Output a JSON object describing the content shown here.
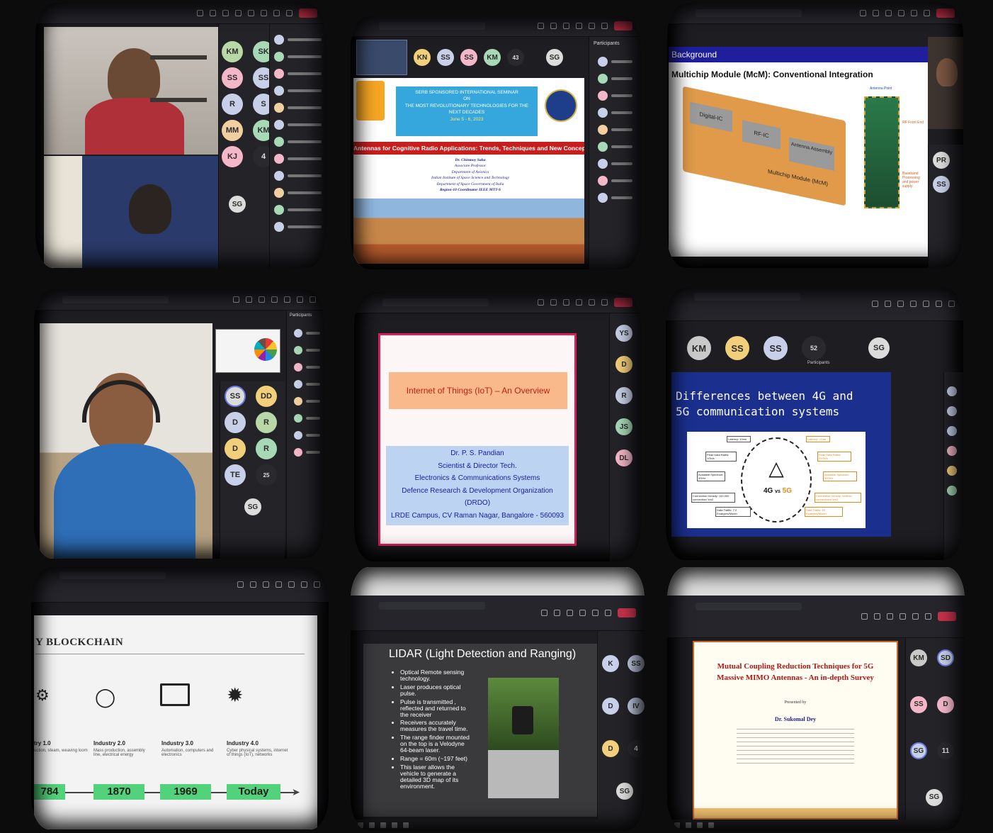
{
  "c1": {
    "participants": [
      "KM",
      "SK",
      "SS",
      "SS",
      "R",
      "S",
      "MM",
      "KM",
      "KJ",
      "4"
    ],
    "self_avatar": "SG"
  },
  "c2": {
    "top_avatars": [
      "KN",
      "SS",
      "SS",
      "KM",
      "43"
    ],
    "self_avatar": "SG",
    "participants_title": "Participants",
    "seminar_line1": "SERB SPONSORED INTERNATIONAL SEMINAR",
    "seminar_line2": "ON",
    "seminar_line3": "THE MOST REVOLUTIONARY TECHNOLOGIES FOR THE",
    "seminar_line4": "NEXT DECADES",
    "seminar_dates": "June 5 - 6, 2023",
    "talk_title": "Antennas for Cognitive Radio Applications: Trends, Techniques and New Concepts",
    "speaker": "Dr. Chinmoy Saha",
    "speaker_role": "Associate Professor",
    "speaker_dept": "Department of Avionics",
    "speaker_inst": "Indian Institute of Space Science and Technology",
    "speaker_inst2": "Department of Space Government of India",
    "speaker_region": "Region-10 Coordinator IEEE MTT-S"
  },
  "c3": {
    "section": "Background",
    "title": "Multichip Module (McM): Conventional Integration",
    "block1": "Digital-IC",
    "block2": "RF-IC",
    "block3": "Antenna Assembly",
    "module_label": "Multichip Module (McM)",
    "antenna_point": "Antenna Point",
    "rf_front_end": "RF Front End",
    "baseband": "Baseband Processing and power supply",
    "side_avatars": [
      "PR",
      "SS"
    ]
  },
  "c4": {
    "participants_title": "Participants",
    "grid": [
      "SS",
      "DD",
      "D",
      "R",
      "D",
      "R",
      "TE",
      "25"
    ],
    "self_avatar": "SG"
  },
  "c5": {
    "title": "Internet of Things (IoT) – An Overview",
    "speaker": "Dr. P. S. Pandian",
    "role": "Scientist & Director Tech.",
    "division": "Electronics & Communications Systems",
    "org": "Defence Research & Development Organization",
    "org_short": "(DRDO)",
    "address": "LRDE Campus, CV Raman Nagar, Bangalore - 560093",
    "side_avatars": [
      "YS",
      "D",
      "R",
      "JS",
      "DL"
    ]
  },
  "c6": {
    "top_avatars": [
      "KM",
      "SS",
      "SS",
      "52"
    ],
    "self_avatar": "SG",
    "participants_label": "Participants",
    "title_line1": "Differences between 4G and",
    "title_line2": "5G communication systems",
    "tower_label_4g": "4G",
    "tower_label_vs": "vs",
    "tower_label_5g": "5G",
    "left_labels": [
      "Latency: 10ms",
      "Peak Data Rates: 1Gb/s",
      "Available Spectrum: 3GHz",
      "Connection Density: 100,000 connection/ km2",
      "Data Traffic: 7.2 Exabytes/Month"
    ],
    "right_labels": [
      "Latency: <1ms",
      "Peak Data Rates: 20Gb/s",
      "Available Spectrum: 30GHz",
      "Connection Density: 1million connections/ km2",
      "Data Traffic: 50 Exabytes/Month"
    ]
  },
  "c7": {
    "title": "Y BLOCKCHAIN",
    "items": [
      {
        "title": "try 1.0",
        "desc": "uction, steam, weaving loom",
        "year": "784"
      },
      {
        "title": "Industry 2.0",
        "desc": "Mass production, assembly line, electrical energy",
        "year": "1870"
      },
      {
        "title": "Industry 3.0",
        "desc": "Automation, computers and electronics",
        "year": "1969"
      },
      {
        "title": "Industry 4.0",
        "desc": "Cyber physical systems, internet of things (IoT), networks",
        "year": "Today"
      }
    ]
  },
  "c8": {
    "title": "LIDAR (Light Detection and Ranging)",
    "bullets": [
      "Optical Remote sensing technology.",
      "Laser produces optical pulse.",
      "Pulse is transmitted , reflected and returned to the receiver",
      "Receivers accurately measures the travel time.",
      "The range finder mounted on the top is a Velodyne 64-beam laser.",
      "Range = 60m (~197 feet)",
      "This laser allows the vehicle to generate a detailed 3D map of its environment."
    ],
    "side_avatars": [
      "K",
      "SS",
      "D",
      "IV",
      "D",
      "4"
    ],
    "self_avatar": "SG"
  },
  "c9": {
    "title_line1": "Mutual Coupling Reduction Techniques for 5G",
    "title_line2": "Massive MIMO Antennas - An in-depth Survey",
    "presented_by": "Presented by",
    "speaker": "Dr. Sukomal Dey",
    "side_avatars": [
      "KM",
      "SD",
      "SS",
      "D",
      "SG",
      "11"
    ],
    "self_avatar": "SG"
  },
  "colors": {
    "teams_dark": "#25252b",
    "leave_red": "#c4314b",
    "green_band": "#52d27a",
    "slide_blue": "#1b1b8f"
  }
}
